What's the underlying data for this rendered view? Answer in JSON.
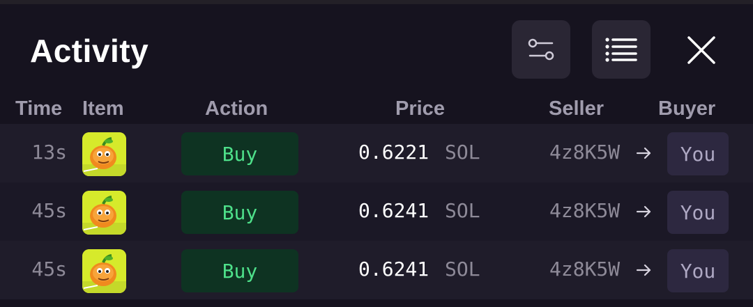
{
  "panel": {
    "title": "Activity"
  },
  "toolbar": {
    "filter_icon": "filter-sliders-icon",
    "list_icon": "list-icon",
    "close_icon": "close-icon"
  },
  "columns": {
    "time": "Time",
    "item": "Item",
    "action": "Action",
    "price": "Price",
    "seller": "Seller",
    "buyer": "Buyer"
  },
  "rows": [
    {
      "time": "13s",
      "item_icon": "peach-nft-thumbnail",
      "action": "Buy",
      "price": "0.6221",
      "unit": "SOL",
      "seller": "4z8K5W",
      "buyer": "You"
    },
    {
      "time": "45s",
      "item_icon": "peach-nft-thumbnail",
      "action": "Buy",
      "price": "0.6241",
      "unit": "SOL",
      "seller": "4z8K5W",
      "buyer": "You"
    },
    {
      "time": "45s",
      "item_icon": "peach-nft-thumbnail",
      "action": "Buy",
      "price": "0.6241",
      "unit": "SOL",
      "seller": "4z8K5W",
      "buyer": "You"
    }
  ],
  "colors": {
    "background": "#16131f",
    "buy_text": "#4ee08a",
    "buy_bg": "#0e3322",
    "you_bg": "#2d2840",
    "muted": "#8e8a98"
  }
}
